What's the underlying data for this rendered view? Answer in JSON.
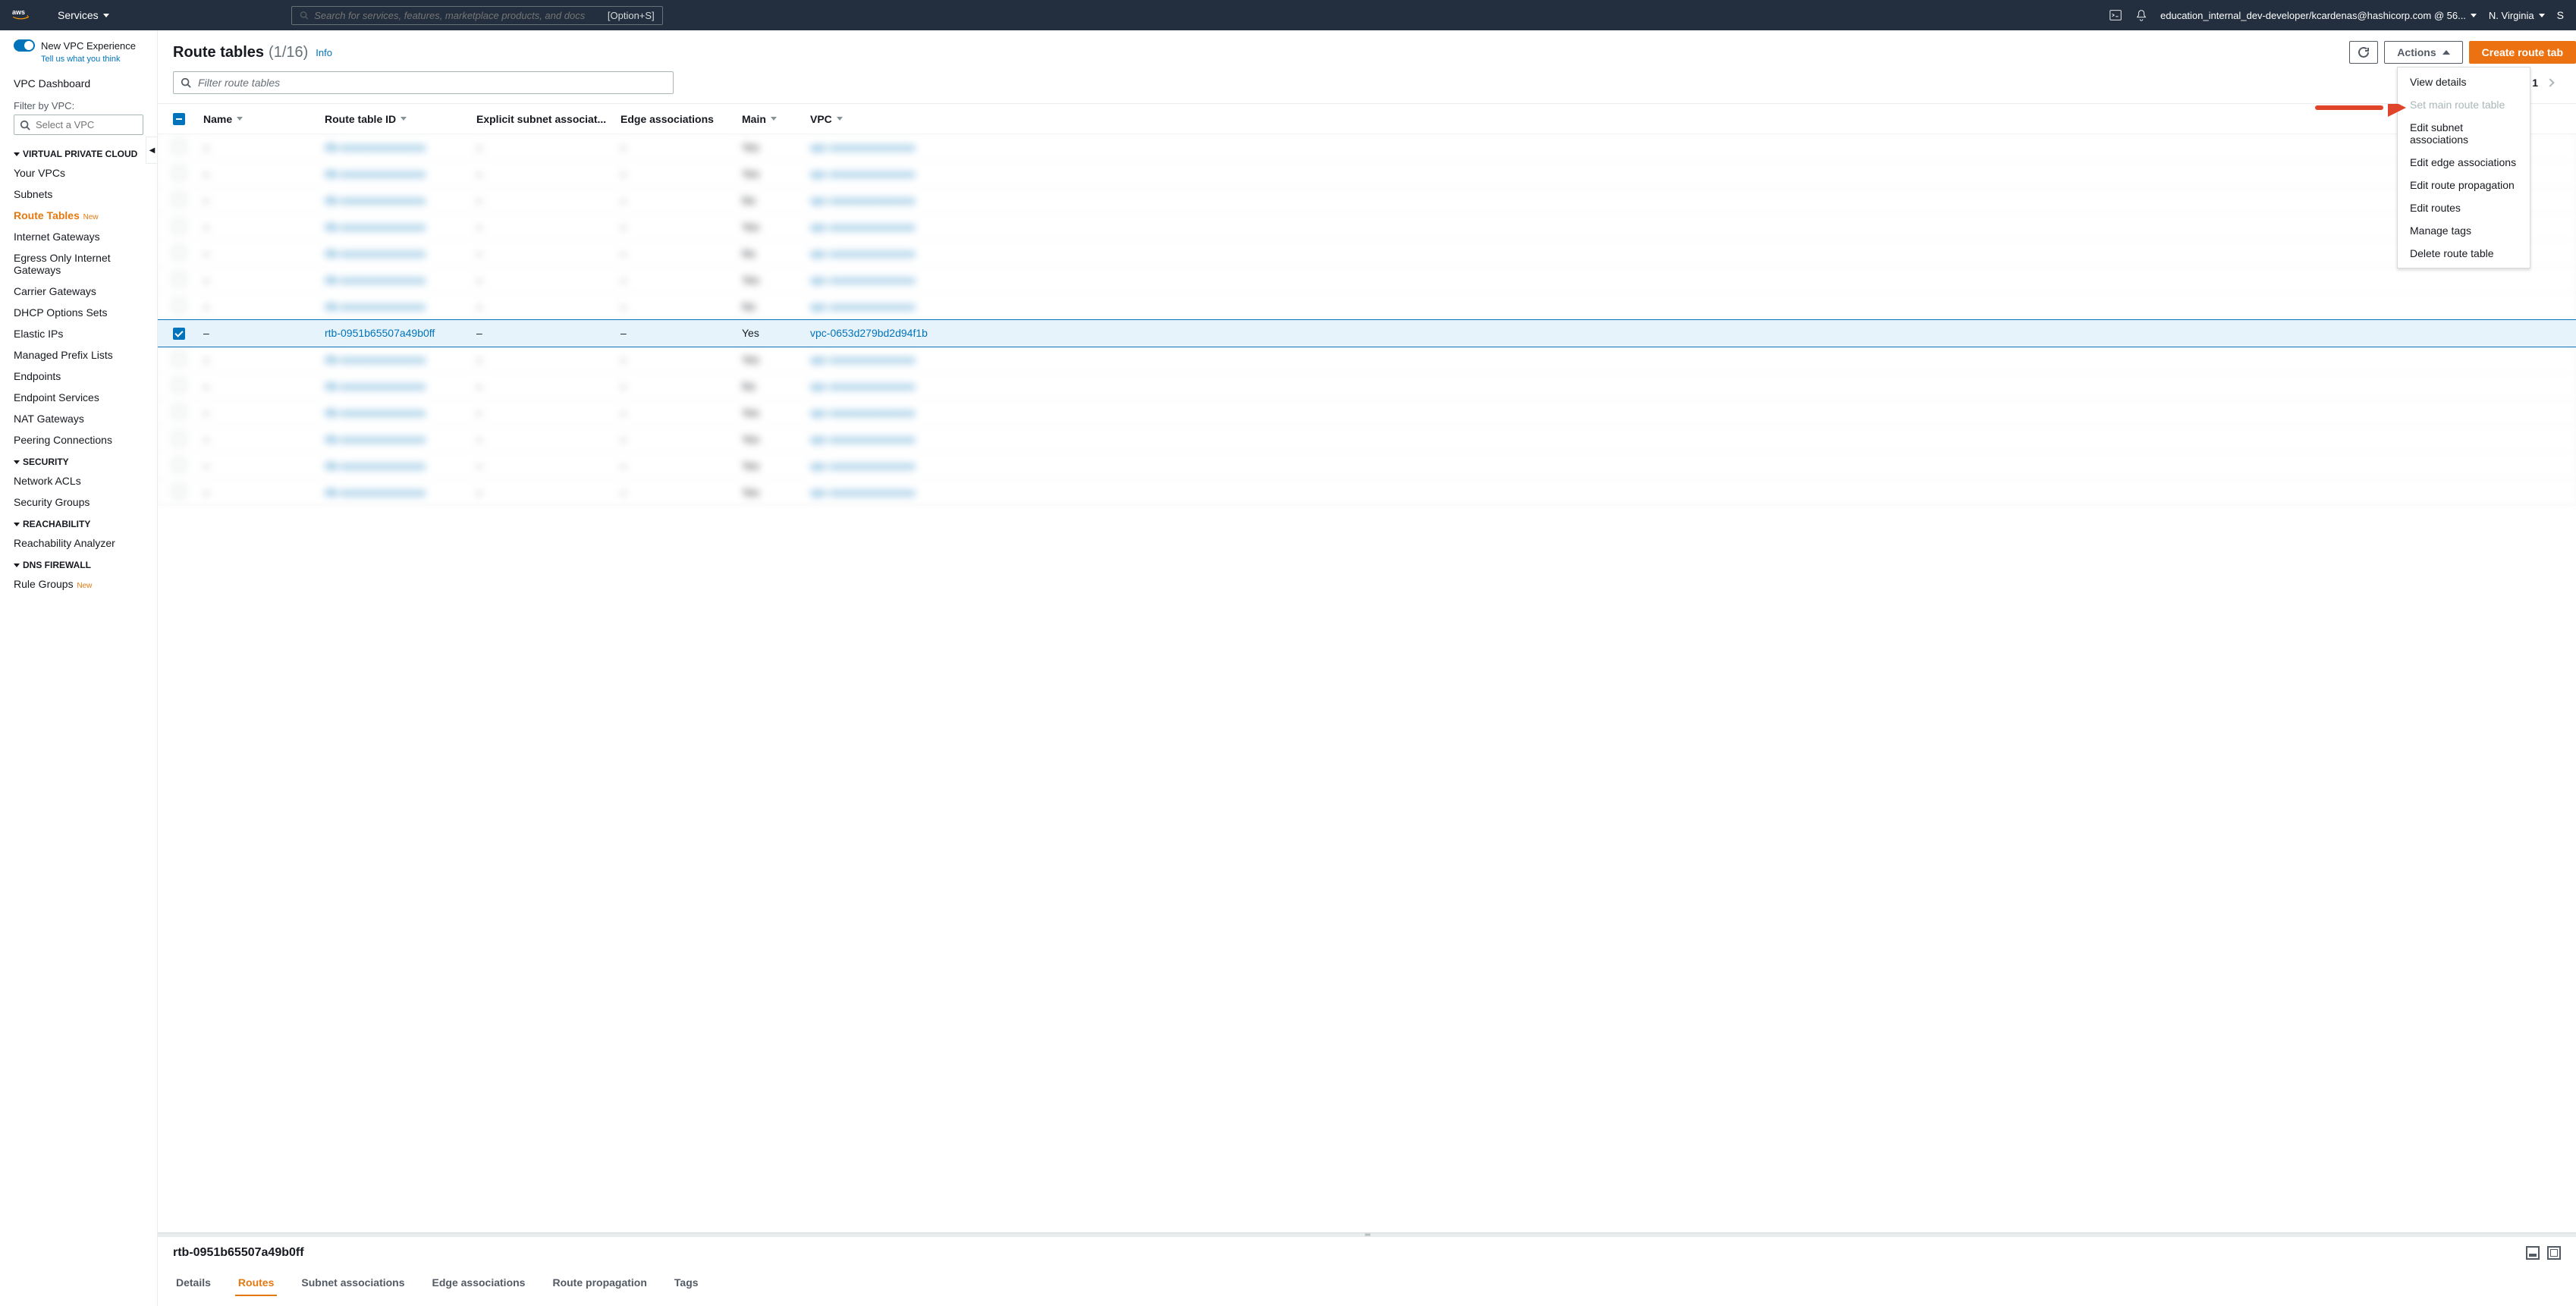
{
  "topbar": {
    "services": "Services",
    "search_placeholder": "Search for services, features, marketplace products, and docs",
    "search_shortcut": "[Option+S]",
    "account": "education_internal_dev-developer/kcardenas@hashicorp.com @ 56...",
    "region": "N. Virginia",
    "support_letter": "S"
  },
  "sidebar": {
    "new_experience": "New VPC Experience",
    "tell_us": "Tell us what you think",
    "dashboard": "VPC Dashboard",
    "filter_label": "Filter by VPC:",
    "filter_placeholder": "Select a VPC",
    "sections": {
      "vpc": {
        "title": "VIRTUAL PRIVATE CLOUD",
        "items": [
          "Your VPCs",
          "Subnets",
          "Route Tables",
          "Internet Gateways",
          "Egress Only Internet Gateways",
          "Carrier Gateways",
          "DHCP Options Sets",
          "Elastic IPs",
          "Managed Prefix Lists",
          "Endpoints",
          "Endpoint Services",
          "NAT Gateways",
          "Peering Connections"
        ],
        "active_index": 2,
        "new_badges": [
          2
        ]
      },
      "security": {
        "title": "SECURITY",
        "items": [
          "Network ACLs",
          "Security Groups"
        ]
      },
      "reachability": {
        "title": "REACHABILITY",
        "items": [
          "Reachability Analyzer"
        ]
      },
      "dns": {
        "title": "DNS FIREWALL",
        "items": [
          "Rule Groups"
        ],
        "new_badges": [
          0
        ]
      }
    }
  },
  "page": {
    "title": "Route tables",
    "count": "(1/16)",
    "info": "Info",
    "actions_label": "Actions",
    "create_label": "Create route tab",
    "filter_placeholder": "Filter route tables",
    "page_num": "1"
  },
  "actions_menu": [
    {
      "label": "View details",
      "enabled": true
    },
    {
      "label": "Set main route table",
      "enabled": false
    },
    {
      "label": "Edit subnet associations",
      "enabled": true
    },
    {
      "label": "Edit edge associations",
      "enabled": true
    },
    {
      "label": "Edit route propagation",
      "enabled": true
    },
    {
      "label": "Edit routes",
      "enabled": true
    },
    {
      "label": "Manage tags",
      "enabled": true
    },
    {
      "label": "Delete route table",
      "enabled": true
    }
  ],
  "table": {
    "columns": [
      "Name",
      "Route table ID",
      "Explicit subnet associat...",
      "Edge associations",
      "Main",
      "VPC"
    ],
    "selected_row": {
      "name": "–",
      "route_table_id": "rtb-0951b65507a49b0ff",
      "explicit": "–",
      "edge": "–",
      "main": "Yes",
      "vpc": "vpc-0653d279bd2d94f1b"
    }
  },
  "detail": {
    "title": "rtb-0951b65507a49b0ff",
    "tabs": [
      "Details",
      "Routes",
      "Subnet associations",
      "Edge associations",
      "Route propagation",
      "Tags"
    ],
    "active_tab": 1
  }
}
